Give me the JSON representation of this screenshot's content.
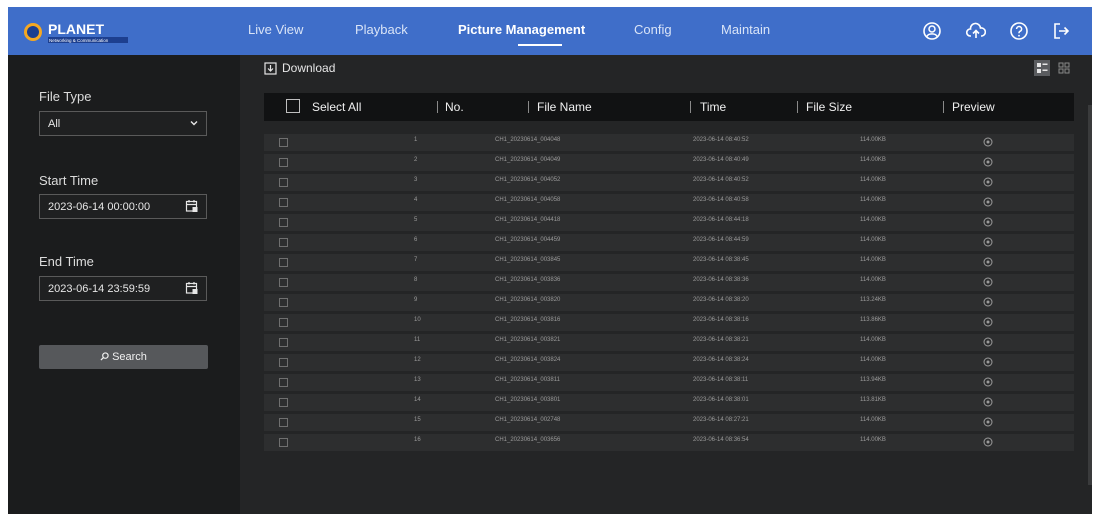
{
  "app": {
    "logo_text": "PLANET",
    "logo_subtext": "Networking & Communication",
    "brand_color": "#3f6ec9"
  },
  "nav": {
    "items": [
      {
        "label": "Live View"
      },
      {
        "label": "Playback"
      },
      {
        "label": "Picture Management",
        "active": true
      },
      {
        "label": "Config"
      },
      {
        "label": "Maintain"
      }
    ],
    "icons": [
      "user-icon",
      "cloud-upload-icon",
      "help-icon",
      "logout-icon"
    ]
  },
  "sidebar": {
    "file_type_label": "File Type",
    "file_type_value": "All",
    "start_time_label": "Start Time",
    "start_time_value": "2023-06-14 00:00:00",
    "end_time_label": "End Time",
    "end_time_value": "2023-06-14 23:59:59",
    "search_label": "Search"
  },
  "main": {
    "download_label": "Download",
    "columns": {
      "select_all": "Select All",
      "no": "No.",
      "file_name": "File Name",
      "time": "Time",
      "file_size": "File Size",
      "preview": "Preview"
    },
    "rows": [
      {
        "no": "1",
        "file_name": "CH1_20230614_004048",
        "time": "2023-06-14 08:40:52",
        "file_size": "114.00KB"
      },
      {
        "no": "2",
        "file_name": "CH1_20230614_004049",
        "time": "2023-06-14 08:40:49",
        "file_size": "114.00KB"
      },
      {
        "no": "3",
        "file_name": "CH1_20230614_004052",
        "time": "2023-06-14 08:40:52",
        "file_size": "114.00KB"
      },
      {
        "no": "4",
        "file_name": "CH1_20230614_004058",
        "time": "2023-06-14 08:40:58",
        "file_size": "114.00KB"
      },
      {
        "no": "5",
        "file_name": "CH1_20230614_004418",
        "time": "2023-06-14 08:44:18",
        "file_size": "114.00KB"
      },
      {
        "no": "6",
        "file_name": "CH1_20230614_004459",
        "time": "2023-06-14 08:44:59",
        "file_size": "114.00KB"
      },
      {
        "no": "7",
        "file_name": "CH1_20230614_003845",
        "time": "2023-06-14 08:38:45",
        "file_size": "114.00KB"
      },
      {
        "no": "8",
        "file_name": "CH1_20230614_003836",
        "time": "2023-06-14 08:38:36",
        "file_size": "114.00KB"
      },
      {
        "no": "9",
        "file_name": "CH1_20230614_003820",
        "time": "2023-06-14 08:38:20",
        "file_size": "113.24KB"
      },
      {
        "no": "10",
        "file_name": "CH1_20230614_003816",
        "time": "2023-06-14 08:38:16",
        "file_size": "113.86KB"
      },
      {
        "no": "11",
        "file_name": "CH1_20230614_003821",
        "time": "2023-06-14 08:38:21",
        "file_size": "114.00KB"
      },
      {
        "no": "12",
        "file_name": "CH1_20230614_003824",
        "time": "2023-06-14 08:38:24",
        "file_size": "114.00KB"
      },
      {
        "no": "13",
        "file_name": "CH1_20230614_003811",
        "time": "2023-06-14 08:38:11",
        "file_size": "113.94KB"
      },
      {
        "no": "14",
        "file_name": "CH1_20230614_003801",
        "time": "2023-06-14 08:38:01",
        "file_size": "113.81KB"
      },
      {
        "no": "15",
        "file_name": "CH1_20230614_002748",
        "time": "2023-06-14 08:27:21",
        "file_size": "114.00KB"
      },
      {
        "no": "16",
        "file_name": "CH1_20230614_003656",
        "time": "2023-06-14 08:36:54",
        "file_size": "114.00KB"
      }
    ]
  }
}
